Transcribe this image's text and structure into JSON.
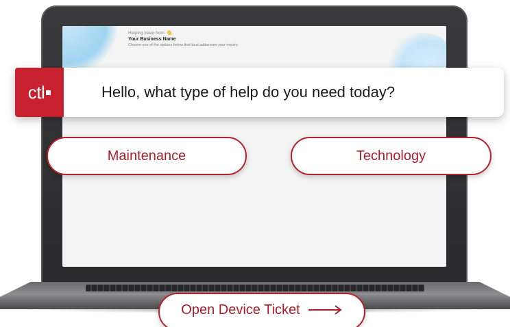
{
  "screen": {
    "kicker": "Helping keep from",
    "wave_emoji": "👋",
    "business_name": "Your Business Name",
    "subtitle": "Choose one of the options below that best addresses your inquiry."
  },
  "brand": {
    "logo_text": "ctl",
    "color": "#c8202f"
  },
  "prompt": {
    "text": "Hello, what type of help do you need today?"
  },
  "options": [
    {
      "label": "Maintenance"
    },
    {
      "label": "Technology"
    }
  ],
  "cta": {
    "label": "Open Device Ticket",
    "icon": "arrow-right-icon"
  },
  "colors": {
    "accent": "#b5212c",
    "screen_bg": "#f4f4f4",
    "laptop": "#2f2f31"
  }
}
